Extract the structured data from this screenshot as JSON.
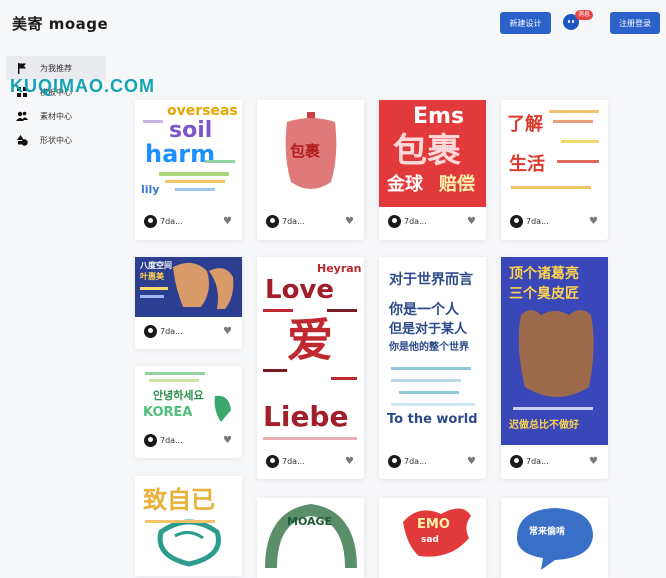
{
  "header": {
    "brand": "美寄 moage",
    "new_design": "新建设计",
    "message_badge": "消息",
    "login": "注册登录"
  },
  "sidebar": {
    "items": [
      {
        "label": "为我推荐",
        "icon": "flag-icon"
      },
      {
        "label": "模板中心",
        "icon": "grid-icon"
      },
      {
        "label": "素材中心",
        "icon": "users-icon"
      },
      {
        "label": "形状中心",
        "icon": "shapes-icon"
      }
    ]
  },
  "watermark": "KUQIMAO.COM",
  "cards": [
    {
      "author": "7da...",
      "words": [
        "overseas",
        "soil",
        "harm",
        "lily"
      ]
    },
    {
      "author": "7da...",
      "words": [
        "包裹"
      ]
    },
    {
      "author": "7da...",
      "words": [
        "Ems",
        "包裹",
        "金球",
        "赔偿"
      ]
    },
    {
      "author": "7da...",
      "words": [
        "了解",
        "生活"
      ]
    },
    {
      "author": "7da...",
      "words": [
        "八度空间",
        "叶惠美"
      ]
    },
    {
      "author": "7da...",
      "words": [
        "Love",
        "爱",
        "Liebe",
        "Heyran"
      ]
    },
    {
      "author": "7da...",
      "words": [
        "对于世界而言",
        "你是一个人",
        "但是对于某人",
        "你是他的整个世界",
        "To the world"
      ]
    },
    {
      "author": "7da...",
      "words": [
        "顶个诸葛亮",
        "三个臭皮匠",
        "迟做总比不做好"
      ]
    },
    {
      "author": "7da...",
      "words": [
        "안녕하세요",
        "KOREA"
      ]
    },
    {
      "author": "",
      "words": [
        "致自已"
      ]
    },
    {
      "author": "",
      "words": [
        "MOAGE"
      ]
    },
    {
      "author": "",
      "words": [
        "EMO",
        "sad"
      ]
    },
    {
      "author": "",
      "words": [
        "常来偷啃"
      ]
    }
  ],
  "colors": {
    "accent": "#2a62c9",
    "badge": "#e64545"
  }
}
